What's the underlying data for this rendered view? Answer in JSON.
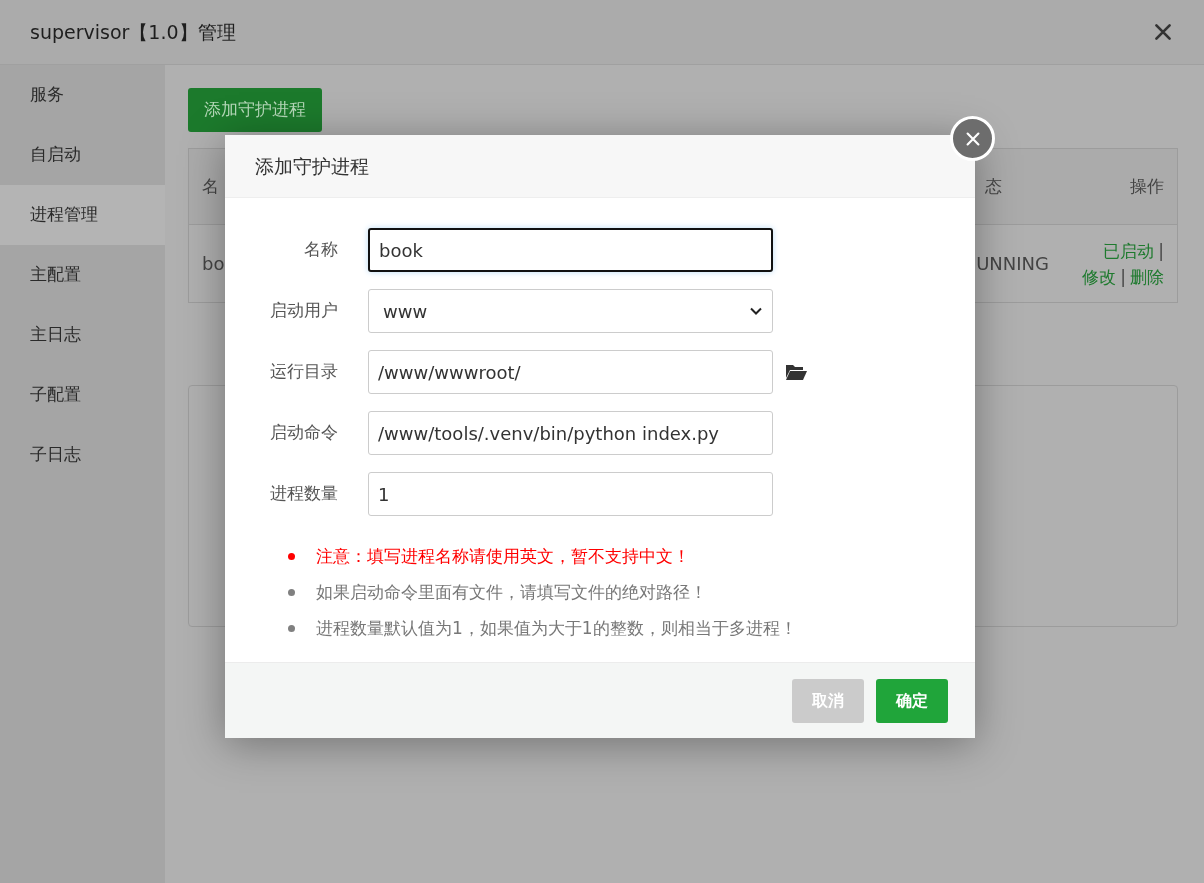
{
  "window": {
    "title": "supervisor【1.0】管理"
  },
  "sidebar": {
    "items": [
      {
        "label": "服务",
        "selected": false
      },
      {
        "label": "自启动",
        "selected": false
      },
      {
        "label": "进程管理",
        "selected": true
      },
      {
        "label": "主配置",
        "selected": false
      },
      {
        "label": "主日志",
        "selected": false
      },
      {
        "label": "子配置",
        "selected": false
      },
      {
        "label": "子日志",
        "selected": false
      }
    ]
  },
  "toolbar": {
    "add_button": "添加守护进程"
  },
  "table": {
    "columns": [
      "名",
      "态",
      "操作"
    ],
    "rows": [
      {
        "cells": [
          "bo",
          "UNNING"
        ],
        "actions": [
          "已启动",
          "修改",
          "删除"
        ],
        "separator": "|"
      }
    ]
  },
  "dialog": {
    "title": "添加守护进程",
    "fields": [
      {
        "label": "名称",
        "kind": "text",
        "value": "book",
        "focused": true
      },
      {
        "label": "启动用户",
        "kind": "select",
        "value": "www",
        "focused": false
      },
      {
        "label": "运行目录",
        "kind": "path",
        "value": "/www/wwwroot/",
        "focused": false
      },
      {
        "label": "启动命令",
        "kind": "text",
        "value": "/www/tools/.venv/bin/python index.py",
        "focused": false
      },
      {
        "label": "进程数量",
        "kind": "text",
        "value": "1",
        "focused": false
      }
    ],
    "notes": [
      {
        "kind": "warning",
        "text": "注意：填写进程名称请使用英文，暂不支持中文！"
      },
      {
        "kind": "info",
        "text": "如果启动命令里面有文件，请填写文件的绝对路径！"
      },
      {
        "kind": "info",
        "text": "进程数量默认值为1，如果值为大于1的整数，则相当于多进程！"
      }
    ],
    "buttons": [
      {
        "label": "取消",
        "kind": "cancel"
      },
      {
        "label": "确定",
        "kind": "primary"
      }
    ]
  }
}
